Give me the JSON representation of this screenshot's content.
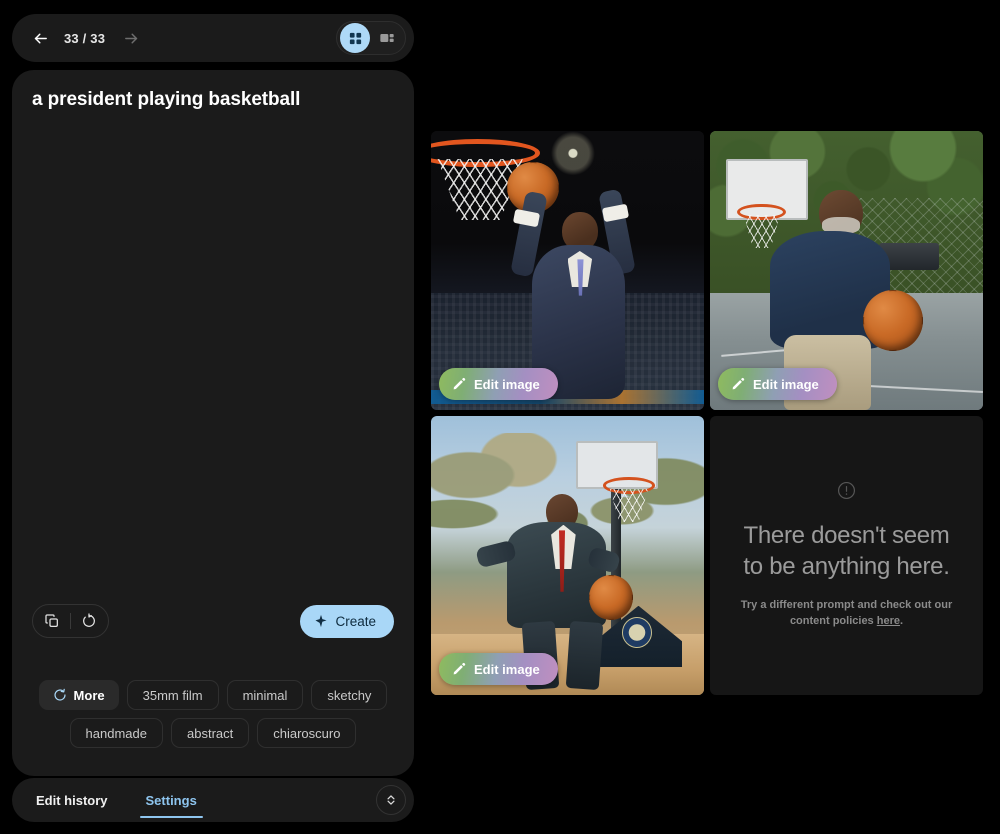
{
  "nav": {
    "back_icon": "arrow-left-icon",
    "forward_icon": "arrow-right-icon",
    "counter": "33 / 33",
    "view_grid_icon": "grid-view-icon",
    "view_detail_icon": "detail-view-icon"
  },
  "prompt": {
    "text": "a president playing basketball",
    "copy_icon": "copy-icon",
    "reset_icon": "reset-icon",
    "create_label": "Create",
    "create_icon": "sparkle-icon",
    "create_bg": "#a9d7f7"
  },
  "chips": {
    "row1": [
      {
        "label": "More",
        "icon": "refresh-icon",
        "filled": true
      },
      {
        "label": "35mm film",
        "icon": "",
        "filled": false
      },
      {
        "label": "minimal",
        "icon": "",
        "filled": false
      },
      {
        "label": "sketchy",
        "icon": "",
        "filled": false
      }
    ],
    "row2": [
      {
        "label": "handmade",
        "icon": "",
        "filled": false
      },
      {
        "label": "abstract",
        "icon": "",
        "filled": false
      },
      {
        "label": "chiaroscuro",
        "icon": "",
        "filled": false
      }
    ]
  },
  "tabs": {
    "items": [
      {
        "label": "Edit history",
        "active": false
      },
      {
        "label": "Settings",
        "active": true
      }
    ],
    "expand_icon": "expand-chevrons-icon",
    "active_color": "#8ec5ef"
  },
  "results": {
    "edit_label": "Edit image",
    "edit_icon": "pencil-icon",
    "tiles": [
      {
        "id": "tile-1",
        "alt": "Man in navy suit laying the basketball into the hoop in an arena",
        "has_edit": true
      },
      {
        "id": "tile-2",
        "alt": "Smiling bearded man in navy polo holding a basketball on an outdoor court",
        "has_edit": true
      },
      {
        "id": "tile-3",
        "alt": "Man in dark suit with red tie dribbling a basketball on a park court",
        "has_edit": true
      },
      {
        "id": "tile-4",
        "alt": "Empty result placeholder",
        "has_edit": false
      }
    ],
    "empty": {
      "icon": "alert-circle-icon",
      "title": "There doesn't seem to be anything here.",
      "subtitle_before": "Try a different prompt and check out our content policies ",
      "link": "here",
      "subtitle_after": "."
    }
  }
}
